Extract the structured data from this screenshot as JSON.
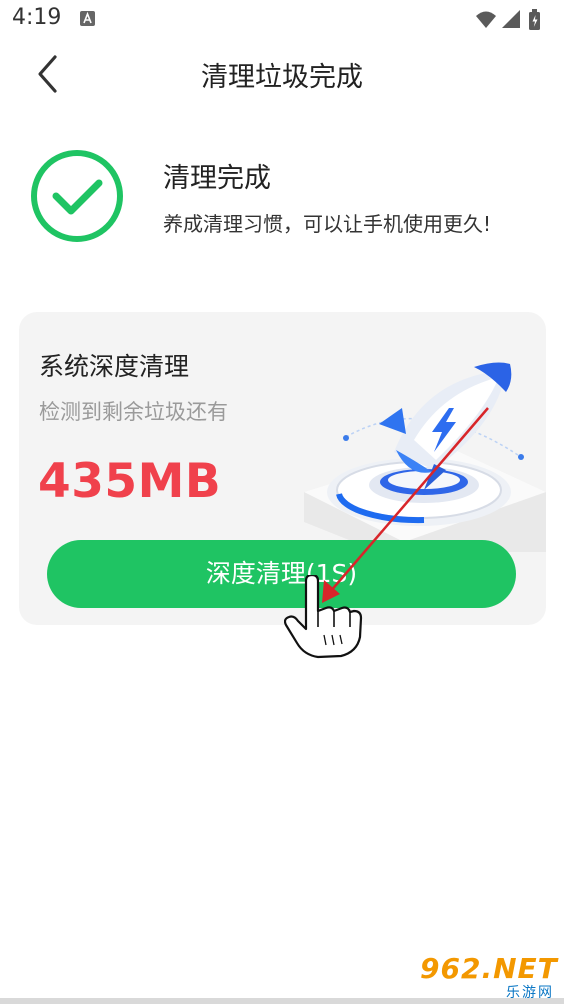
{
  "status_bar": {
    "time": "4:19",
    "icons": [
      "notification-a-icon",
      "wifi-icon",
      "signal-icon",
      "battery-icon"
    ]
  },
  "header": {
    "title": "清理垃圾完成",
    "back_icon": "chevron-left-icon"
  },
  "result": {
    "title": "清理完成",
    "subtitle": "养成清理习惯，可以让手机使用更久!",
    "icon": "check-circle-icon"
  },
  "deep_clean_card": {
    "title": "系统深度清理",
    "description": "检测到剩余垃圾还有",
    "size": "435MB",
    "button_label": "深度清理(1S)"
  },
  "watermark": {
    "brand": "962.NET",
    "subtitle": "乐游网"
  },
  "colors": {
    "accent_green": "#1fc463",
    "size_red": "#f0414c",
    "card_bg": "#f4f4f4",
    "annotation_arrow": "#d8252a",
    "watermark_orange": "#f39800",
    "watermark_blue": "#0b77c5"
  }
}
